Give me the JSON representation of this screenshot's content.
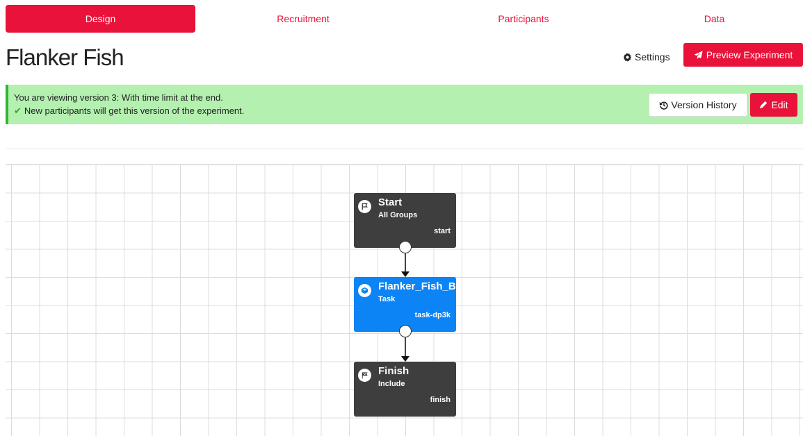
{
  "tabs": [
    {
      "label": "Design",
      "active": true
    },
    {
      "label": "Recruitment",
      "active": false
    },
    {
      "label": "Participants",
      "active": false
    },
    {
      "label": "Data",
      "active": false
    }
  ],
  "header": {
    "title": "Flanker Fish",
    "settings_label": "Settings",
    "preview_label": "Preview Experiment"
  },
  "banner": {
    "line1": "You are viewing version 3: With time limit at the end.",
    "line2": "New participants will get this version of the experiment.",
    "version_history_label": "Version History",
    "edit_label": "Edit"
  },
  "flow": {
    "nodes": [
      {
        "title": "Start",
        "subtitle": "All Groups",
        "id": "start",
        "icon": "flag-icon"
      },
      {
        "title": "Flanker_Fish_B",
        "subtitle": "Task",
        "id": "task-dp3k",
        "icon": "task-icon"
      },
      {
        "title": "Finish",
        "subtitle": "Include",
        "id": "finish",
        "icon": "checkered-flag-icon"
      }
    ]
  },
  "colors": {
    "accent": "#e8123a",
    "banner_bg": "#b4f0b0",
    "banner_border": "#31b531",
    "node_dark": "#3e3e3e",
    "node_blue": "#0d84f5"
  }
}
